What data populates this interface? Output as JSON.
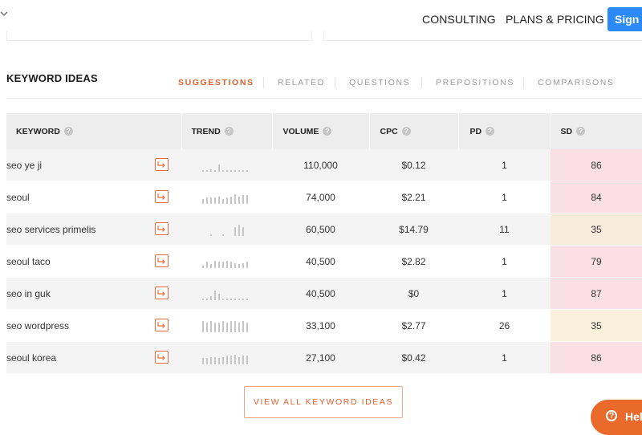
{
  "nav": {
    "consulting": "CONSULTING",
    "plans": "PLANS & PRICING",
    "signin": "Sign in"
  },
  "section": {
    "title": "KEYWORD IDEAS"
  },
  "tabs": [
    {
      "label": "SUGGESTIONS",
      "active": true
    },
    {
      "label": "RELATED",
      "active": false
    },
    {
      "label": "QUESTIONS",
      "active": false
    },
    {
      "label": "PREPOSITIONS",
      "active": false
    },
    {
      "label": "COMPARISONS",
      "active": false
    }
  ],
  "table": {
    "columns": [
      "KEYWORD",
      "TREND",
      "VOLUME",
      "CPC",
      "PD",
      "SD"
    ],
    "rows": [
      {
        "keyword": "seo ye ji",
        "volume": "110,000",
        "cpc": "$0.12",
        "pd": "1",
        "sd": "86",
        "sd_color": "#fae0e4",
        "trend": [
          1,
          1,
          2,
          1,
          6,
          1,
          1,
          1,
          1,
          1,
          1,
          1
        ]
      },
      {
        "keyword": "seoul",
        "volume": "74,000",
        "cpc": "$2.21",
        "pd": "1",
        "sd": "84",
        "sd_color": "#fae0e4",
        "trend": [
          4,
          5,
          5,
          5,
          6,
          4,
          5,
          6,
          8,
          6,
          7,
          7
        ]
      },
      {
        "keyword": "seo services primelis",
        "volume": "60,500",
        "cpc": "$14.79",
        "pd": "11",
        "sd": "35",
        "sd_color": "#f9ebdc",
        "trend": [
          0,
          0,
          1,
          0,
          0,
          1,
          0,
          0,
          7,
          9,
          7,
          0
        ]
      },
      {
        "keyword": "seoul taco",
        "volume": "40,500",
        "cpc": "$2.82",
        "pd": "1",
        "sd": "79",
        "sd_color": "#fae0e4",
        "trend": [
          2,
          5,
          3,
          6,
          5,
          5,
          6,
          5,
          4,
          3,
          4,
          5
        ]
      },
      {
        "keyword": "seo in guk",
        "volume": "40,500",
        "cpc": "$0",
        "pd": "1",
        "sd": "87",
        "sd_color": "#fae0e4",
        "trend": [
          1,
          1,
          3,
          8,
          5,
          1,
          1,
          1,
          1,
          1,
          1,
          1
        ]
      },
      {
        "keyword": "seo wordpress",
        "volume": "33,100",
        "cpc": "$2.77",
        "pd": "26",
        "sd": "35",
        "sd_color": "#fbf0dc",
        "trend": [
          9,
          8,
          9,
          8,
          8,
          9,
          8,
          9,
          9,
          8,
          9,
          8
        ]
      },
      {
        "keyword": "seoul korea",
        "volume": "27,100",
        "cpc": "$0.42",
        "pd": "1",
        "sd": "86",
        "sd_color": "#fae0e4",
        "trend": [
          5,
          5,
          6,
          6,
          5,
          6,
          7,
          7,
          8,
          6,
          7,
          7
        ]
      }
    ]
  },
  "view_all": "VIEW ALL KEYWORD IDEAS",
  "help": "Help",
  "colors": {
    "accent": "#e2602f",
    "signin": "#2b8af7",
    "help": "#e96a2b"
  }
}
